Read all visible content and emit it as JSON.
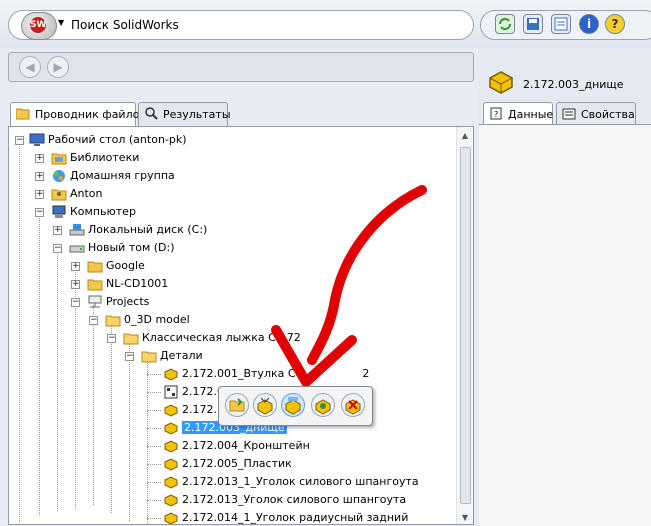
{
  "search": {
    "label": "Поиск SolidWorks"
  },
  "left_tabs": [
    {
      "label": "Проводник файлов"
    },
    {
      "label": "Результаты"
    }
  ],
  "right": {
    "title": "2.172.003_днище",
    "tabs": [
      {
        "label": "Данные"
      },
      {
        "label": "Свойства"
      }
    ]
  },
  "tree": {
    "desktop": "Рабочий стол (anton-pk)",
    "libraries": "Библиотеки",
    "homegroup": "Домашняя группа",
    "anton": "Anton",
    "computer": "Компьютер",
    "diskC": "Локальный диск (C:)",
    "diskD": "Новый том (D:)",
    "google": "Google",
    "nlcd": "NL-CD1001",
    "projects": "Projects",
    "model3d": "0_3D model",
    "ski": "Классическая лыжка С-172",
    "details": "Детали",
    "f1": "2.172.001_Втулка Ce",
    "f1b": "2",
    "f2": "2.172.001_В",
    "f3": "2.172.",
    "f4": "2.172.003_днище",
    "f5": "2.172.004_Кронштейн",
    "f6": "2.172.005_Пластик",
    "f7": "2.172.013_1_Уголок силового шпангоута",
    "f8": "2.172.013_Уголок силового шпангоута",
    "f9": "2.172.014_1_Уголок радиусный задний"
  },
  "colors": {
    "accent": "#3399ff",
    "annotation": "#e00000"
  }
}
